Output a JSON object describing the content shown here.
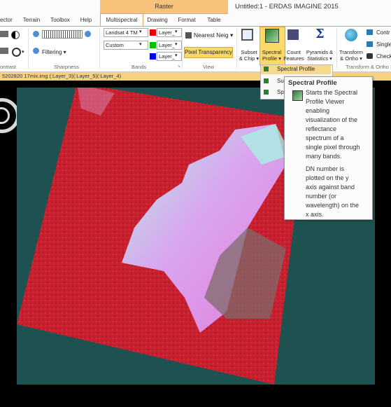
{
  "window_title": "Untitled:1 - ERDAS IMAGINE 2015",
  "context_tab": "Raster",
  "tabs": [
    "ector",
    "Terrain",
    "Toolbox",
    "Help",
    "Multispectral",
    "Drawing",
    "Format",
    "Table"
  ],
  "ribbon": {
    "groups": {
      "contrast": "ontrast",
      "sharpness": "Sharpness",
      "bands": "Bands",
      "view": "View",
      "transform": "Transform & Ortho"
    },
    "filtering_label": "Filtering",
    "sensor_select": "Landsat 4 TM",
    "custom_select": "Custom",
    "layer_red": "Layer_",
    "layer_green": "Layer_",
    "layer_blue": "Layer_",
    "resample_select": "Nearest Neig",
    "pixel_transparency": "Pixel Transparency",
    "subset_chip": [
      "Subset",
      "& Chip"
    ],
    "spectral_profile": [
      "Spectral",
      "Profile"
    ],
    "count_features": [
      "Count",
      "Features"
    ],
    "pyramids_statistics": [
      "Pyramids &",
      "Statistics"
    ],
    "transform_ortho": [
      "Transform",
      "& Ortho"
    ],
    "right_items": [
      "Contr",
      "Single",
      "Check"
    ]
  },
  "file_bar": "5202820 17mix.img (:Layer_3)(:Layer_5)(:Layer_4)",
  "dropdown": {
    "items": [
      "Spectral Profile",
      "Su",
      "Sp"
    ]
  },
  "tooltip": {
    "title": "Spectral Profile",
    "lines": [
      "Starts the Spectral",
      "Profile Viewer",
      "enabling",
      "visualization of the",
      "reflectance",
      "spectrum of a",
      "single pixel through",
      "many bands.",
      "",
      "DN number is",
      "plotted on the y",
      "axis against band",
      "number (or",
      "wavelength) on the",
      "x axis."
    ]
  },
  "colors": {
    "accent": "#f7c37a",
    "file_bar": "#f4d283",
    "viewer_bg": "#000000",
    "image_bg": "#1e5250",
    "scene_red": "#c81e2e",
    "water": "#c89ce6",
    "water_cyan": "#9fe6d8"
  }
}
